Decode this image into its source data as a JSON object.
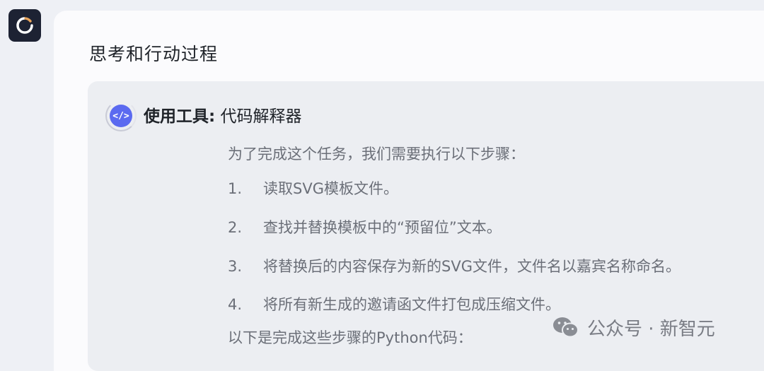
{
  "app": {
    "logo": "circle-spinner-logo"
  },
  "panel": {
    "title": "思考和行动过程",
    "tool": {
      "icon": "code-icon",
      "icon_glyph": "</>",
      "label": "使用工具:",
      "name": "代码解释器"
    },
    "intro": "为了完成这个任务，我们需要执行以下步骤：",
    "steps": [
      {
        "num": "1.",
        "text": "读取SVG模板文件。"
      },
      {
        "num": "2.",
        "text": "查找并替换模板中的“预留位”文本。"
      },
      {
        "num": "3.",
        "text": "将替换后的内容保存为新的SVG文件，文件名以嘉宾名称命名。"
      },
      {
        "num": "4.",
        "text": "将所有新生成的邀请函文件打包成压缩文件。"
      }
    ],
    "outro": "以下是完成这些步骤的Python代码："
  },
  "watermark": {
    "icon": "wechat-icon",
    "text": "公众号 · 新智元"
  }
}
